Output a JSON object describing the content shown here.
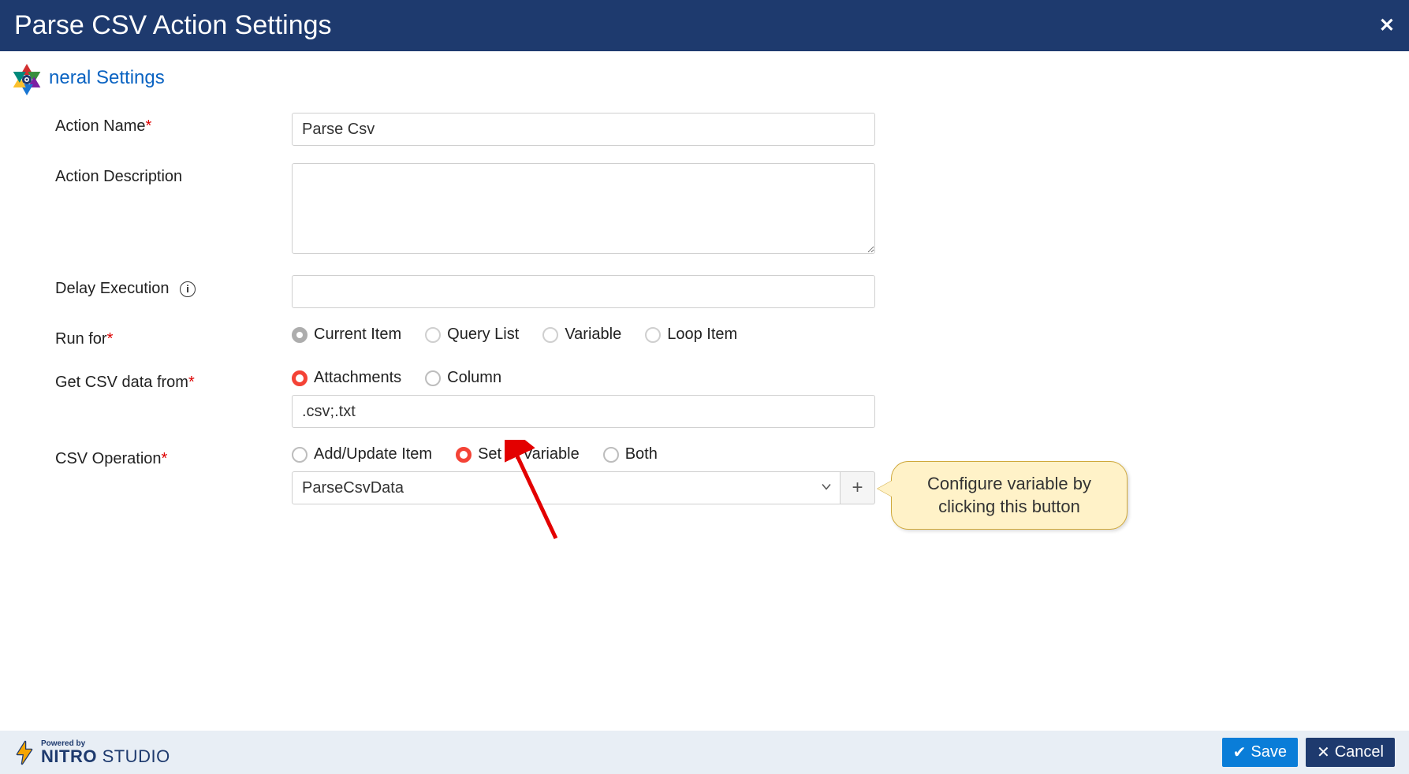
{
  "header": {
    "title": "Parse CSV Action Settings"
  },
  "sectionTitle": "neral Settings",
  "form": {
    "actionName": {
      "label": "Action Name",
      "required": "*",
      "value": "Parse Csv"
    },
    "actionDescription": {
      "label": "Action Description",
      "value": ""
    },
    "delayExecution": {
      "label": "Delay Execution",
      "value": ""
    },
    "runFor": {
      "label": "Run for",
      "required": "*",
      "options": {
        "currentItem": "Current Item",
        "queryList": "Query List",
        "variable": "Variable",
        "loopItem": "Loop Item"
      }
    },
    "getCsv": {
      "label": "Get CSV data from",
      "required": "*",
      "options": {
        "attachments": "Attachments",
        "column": "Column"
      },
      "fileTypes": ".csv;.txt"
    },
    "csvOp": {
      "label": "CSV Operation",
      "required": "*",
      "options": {
        "addUpdate": "Add/Update Item",
        "setInVariable": "Set in Variable",
        "both": "Both"
      },
      "variable": "ParseCsvData"
    }
  },
  "callout": "Configure variable by clicking this button",
  "footer": {
    "poweredBy": "Powered by",
    "brandBold": "NITRO",
    "brandLight": " STUDIO",
    "save": "Save",
    "cancel": "Cancel"
  }
}
